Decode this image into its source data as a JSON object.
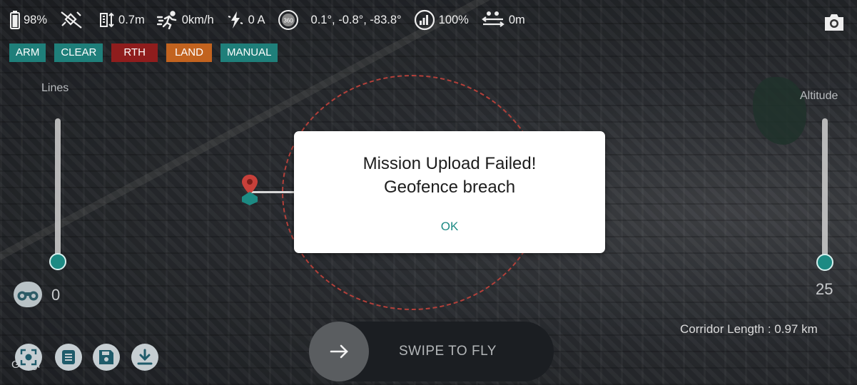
{
  "status": {
    "battery": "98%",
    "distance": "0.7m",
    "speed": "0km/h",
    "current": "0 A",
    "attitude": "0.1°, -0.8°, -83.8°",
    "signal": "100%",
    "height": "0m"
  },
  "commands": [
    {
      "label": "ARM"
    },
    {
      "label": "CLEAR"
    },
    {
      "label": "RTH"
    },
    {
      "label": "LAND"
    },
    {
      "label": "MANUAL"
    }
  ],
  "left_slider": {
    "label": "Lines",
    "value": "0"
  },
  "right_slider": {
    "label": "Altitude",
    "value": "25"
  },
  "corridor_length": "Corridor Length : 0.97 km",
  "swipe": {
    "label": "SWIPE TO FLY"
  },
  "map_attribution": "Googl",
  "dialog": {
    "title_line1": "Mission Upload Failed!",
    "title_line2": "Geofence breach",
    "ok_label": "OK"
  },
  "colors": {
    "accent_teal": "#1f7f7a",
    "rth_red": "#8f1d1d",
    "land_orange": "#c2631f",
    "geofence": "#b3403a"
  }
}
